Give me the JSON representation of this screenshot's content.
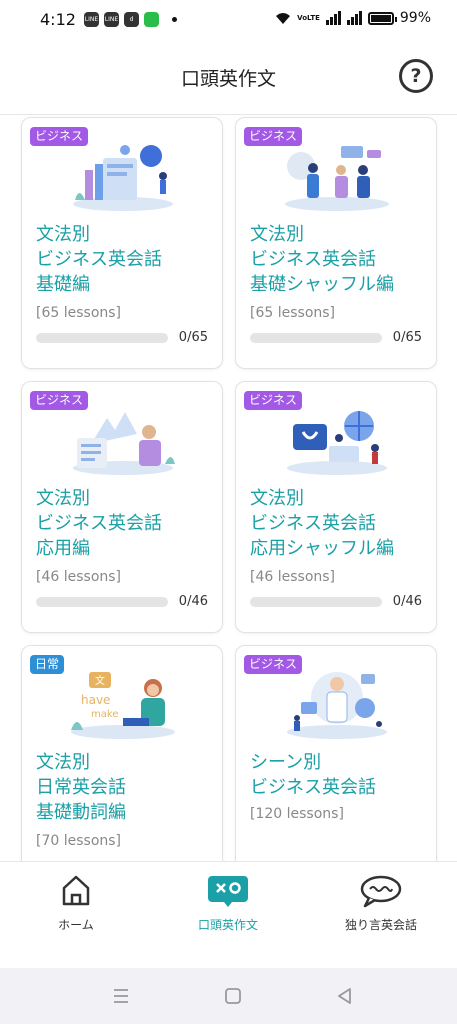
{
  "status_bar": {
    "time": "4:12",
    "battery": "99%",
    "battery_level": 0.99,
    "volte": "VoLTE"
  },
  "header": {
    "title": "口頭英作文",
    "help_icon": "question-circle-icon"
  },
  "cards": [
    {
      "tag": "ビジネス",
      "tag_color": "#a259e6",
      "title": "文法別\nビジネス英会話\n基礎編",
      "lessons": "[65 lessons]",
      "progress_text": "0/65",
      "progress": 0
    },
    {
      "tag": "ビジネス",
      "tag_color": "#a259e6",
      "title": "文法別\nビジネス英会話\n基礎シャッフル編",
      "lessons": "[65 lessons]",
      "progress_text": "0/65",
      "progress": 0
    },
    {
      "tag": "ビジネス",
      "tag_color": "#a259e6",
      "title": "文法別\nビジネス英会話\n応用編",
      "lessons": "[46 lessons]",
      "progress_text": "0/46",
      "progress": 0
    },
    {
      "tag": "ビジネス",
      "tag_color": "#a259e6",
      "title": "文法別\nビジネス英会話\n応用シャッフル編",
      "lessons": "[46 lessons]",
      "progress_text": "0/46",
      "progress": 0
    },
    {
      "tag": "日常",
      "tag_color": "#2d8fd6",
      "title": "文法別\n日常英会話\n基礎動詞編",
      "lessons": "[70 lessons]",
      "illustration_text": [
        "文",
        "have",
        "make"
      ]
    },
    {
      "tag": "ビジネス",
      "tag_color": "#a259e6",
      "title": "シーン別\nビジネス英会話",
      "lessons": "[120 lessons]"
    }
  ],
  "tabbar": {
    "tabs": [
      {
        "label": "ホーム",
        "icon": "home-icon"
      },
      {
        "label": "口頭英作文",
        "icon": "quiz-icon",
        "active": true
      },
      {
        "label": "独り言英会話",
        "icon": "chat-bubble-icon"
      }
    ]
  },
  "colors": {
    "accent": "#1aa0a6",
    "business_tag": "#a259e6",
    "daily_tag": "#2d8fd6"
  }
}
